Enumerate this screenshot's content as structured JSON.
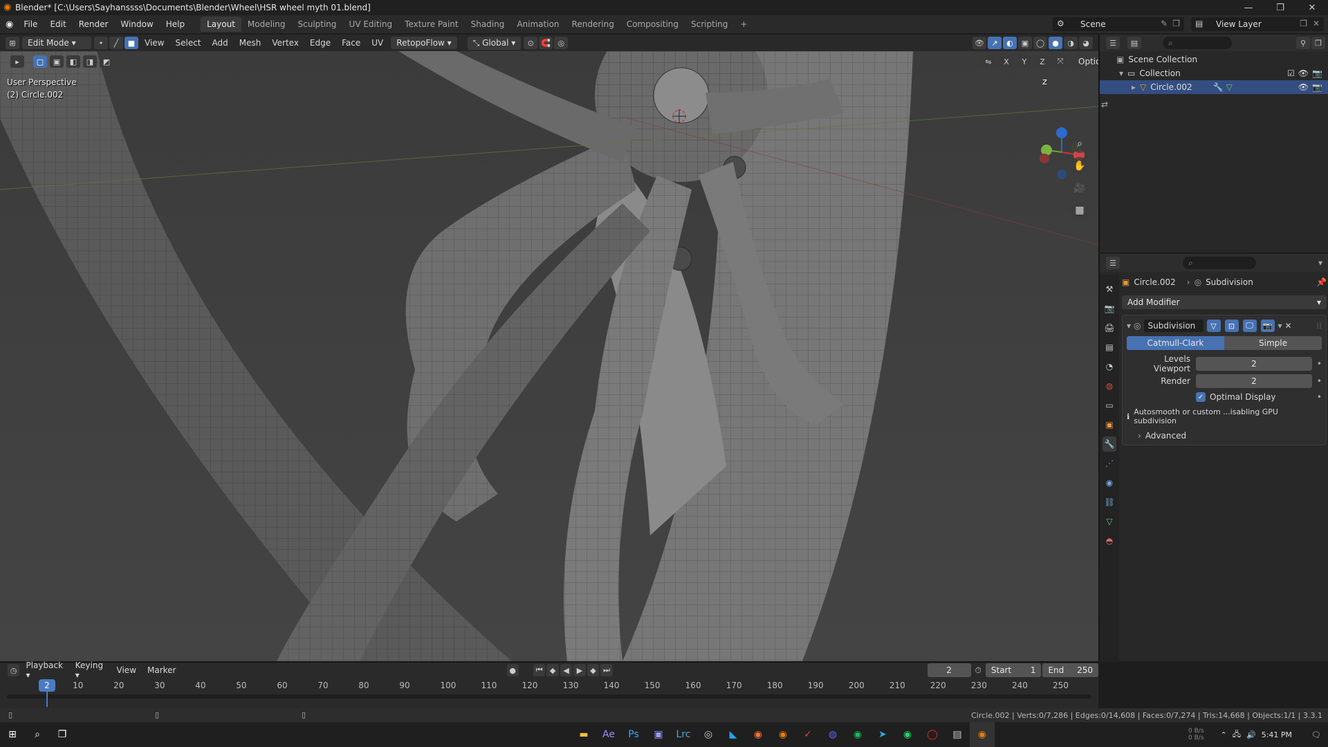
{
  "title_bar": {
    "title": "Blender* [C:\\Users\\Sayhanssss\\Documents\\Blender\\Wheel\\HSR wheel myth 01.blend]",
    "minimize": "—",
    "maximize": "❐",
    "close": "✕"
  },
  "menu": [
    "File",
    "Edit",
    "Render",
    "Window",
    "Help"
  ],
  "workspaces": {
    "active": "Layout",
    "tabs": [
      "Layout",
      "Modeling",
      "Sculpting",
      "UV Editing",
      "Texture Paint",
      "Shading",
      "Animation",
      "Rendering",
      "Compositing",
      "Scripting"
    ],
    "add": "+"
  },
  "scene": "Scene",
  "view_layer": "View Layer",
  "viewport_header": {
    "mode": "Edit Mode",
    "menus": [
      "View",
      "Select",
      "Add",
      "Mesh",
      "Vertex",
      "Edge",
      "Face",
      "UV"
    ],
    "addon": "RetopoFlow",
    "orientation": "Global",
    "options": "Options",
    "axes": [
      "X",
      "Y",
      "Z"
    ]
  },
  "viewport": {
    "perspective": "User Perspective",
    "object_label": "(2) Circle.002",
    "gizmo_axes": {
      "x": "X",
      "y": "Y",
      "z": "Z"
    }
  },
  "outliner": {
    "scene_collection": "Scene Collection",
    "collection": "Collection",
    "object": "Circle.002"
  },
  "properties": {
    "breadcrumb_object": "Circle.002",
    "breadcrumb_modifier": "Subdivision",
    "add_modifier": "Add Modifier",
    "modifier_name": "Subdivision",
    "type_options": [
      "Catmull-Clark",
      "Simple"
    ],
    "type_selected": "Catmull-Clark",
    "levels_viewport_label": "Levels Viewport",
    "levels_viewport_value": "2",
    "render_label": "Render",
    "render_value": "2",
    "optimal_display_label": "Optimal Display",
    "optimal_display_checked": true,
    "info_message": "Autosmooth or custom ...isabling GPU subdivision",
    "advanced": "Advanced"
  },
  "timeline": {
    "menus": [
      "Playback",
      "Keying",
      "View",
      "Marker"
    ],
    "current_frame": "2",
    "start_label": "Start",
    "start_value": "1",
    "end_label": "End",
    "end_value": "250",
    "frame_ticks": [
      "10",
      "20",
      "30",
      "40",
      "50",
      "60",
      "70",
      "80",
      "90",
      "100",
      "110",
      "120",
      "130",
      "140",
      "150",
      "160",
      "170",
      "180",
      "190",
      "200",
      "210",
      "220",
      "230",
      "240",
      "250"
    ],
    "playhead": 2,
    "frame_range": [
      1,
      250
    ]
  },
  "statusbar": {
    "stats": "Circle.002 | Verts:0/7,286 | Edges:0/14,608 | Faces:0/7,274 | Tris:14,668 | Objects:1/1 | 3.3.1"
  },
  "taskbar": {
    "time": "5:41 PM",
    "net_up": "0 B/s",
    "net_down": "0 B/s"
  },
  "colors": {
    "accent": "#4772b3",
    "active_blue": "#4a7bc4",
    "orange_active": "#e69b3f"
  }
}
